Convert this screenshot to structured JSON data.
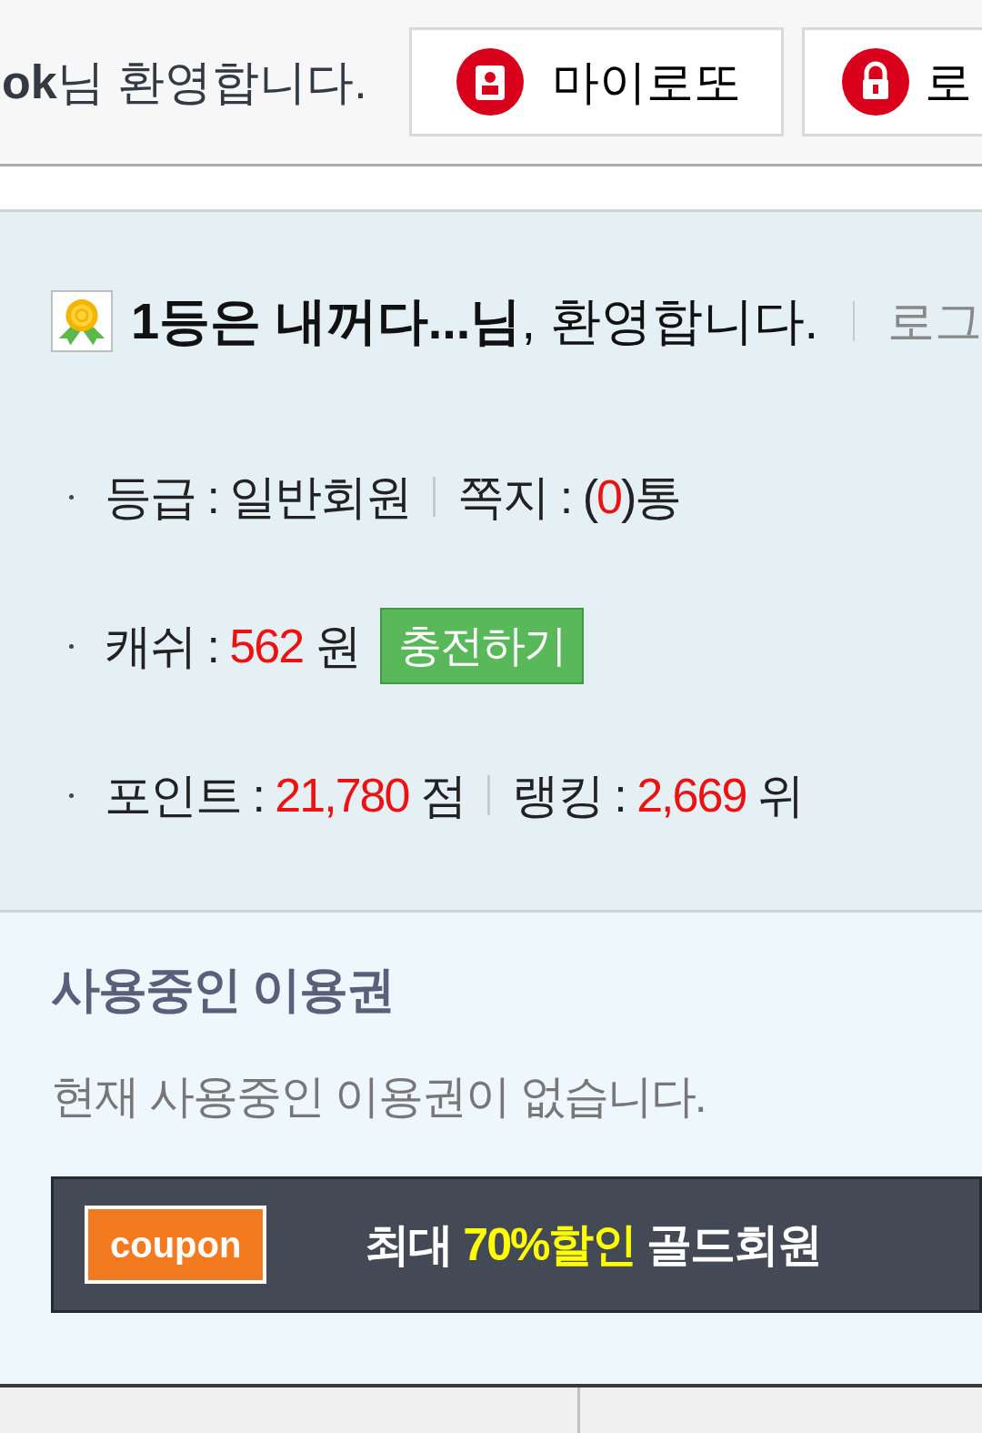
{
  "top_bar": {
    "user": "ok",
    "greeting": "님 환영합니다.",
    "buttons": [
      {
        "label": "마이로또"
      },
      {
        "label": "로"
      }
    ]
  },
  "profile": {
    "nickname": "1등은 내꺼다...님",
    "greeting": ", 환영합니다.",
    "logout": "로그",
    "rows": [
      {
        "items": [
          {
            "label": "등급 : ",
            "value": "일반회원",
            "highlight": false
          },
          {
            "label": "쪽지 : (",
            "value": "0",
            "highlight": true,
            "suffix": ")통"
          }
        ]
      },
      {
        "items": [
          {
            "label": "캐쉬 : ",
            "value": "562",
            "highlight": true,
            "suffix": " 원"
          }
        ],
        "button": "충전하기"
      },
      {
        "items": [
          {
            "label": "포인트 : ",
            "value": "21,780",
            "highlight": true,
            "suffix": " 점"
          },
          {
            "label": "랭킹 : ",
            "value": "2,669",
            "highlight": true,
            "suffix": " 위"
          }
        ]
      }
    ]
  },
  "passes": {
    "title": "사용중인 이용권",
    "message": "현재 사용중인 이용권이 없습니다."
  },
  "banner": {
    "badge": "coupon",
    "text_before": "최대",
    "highlight": "70%할인",
    "text_after": "골드회원"
  }
}
